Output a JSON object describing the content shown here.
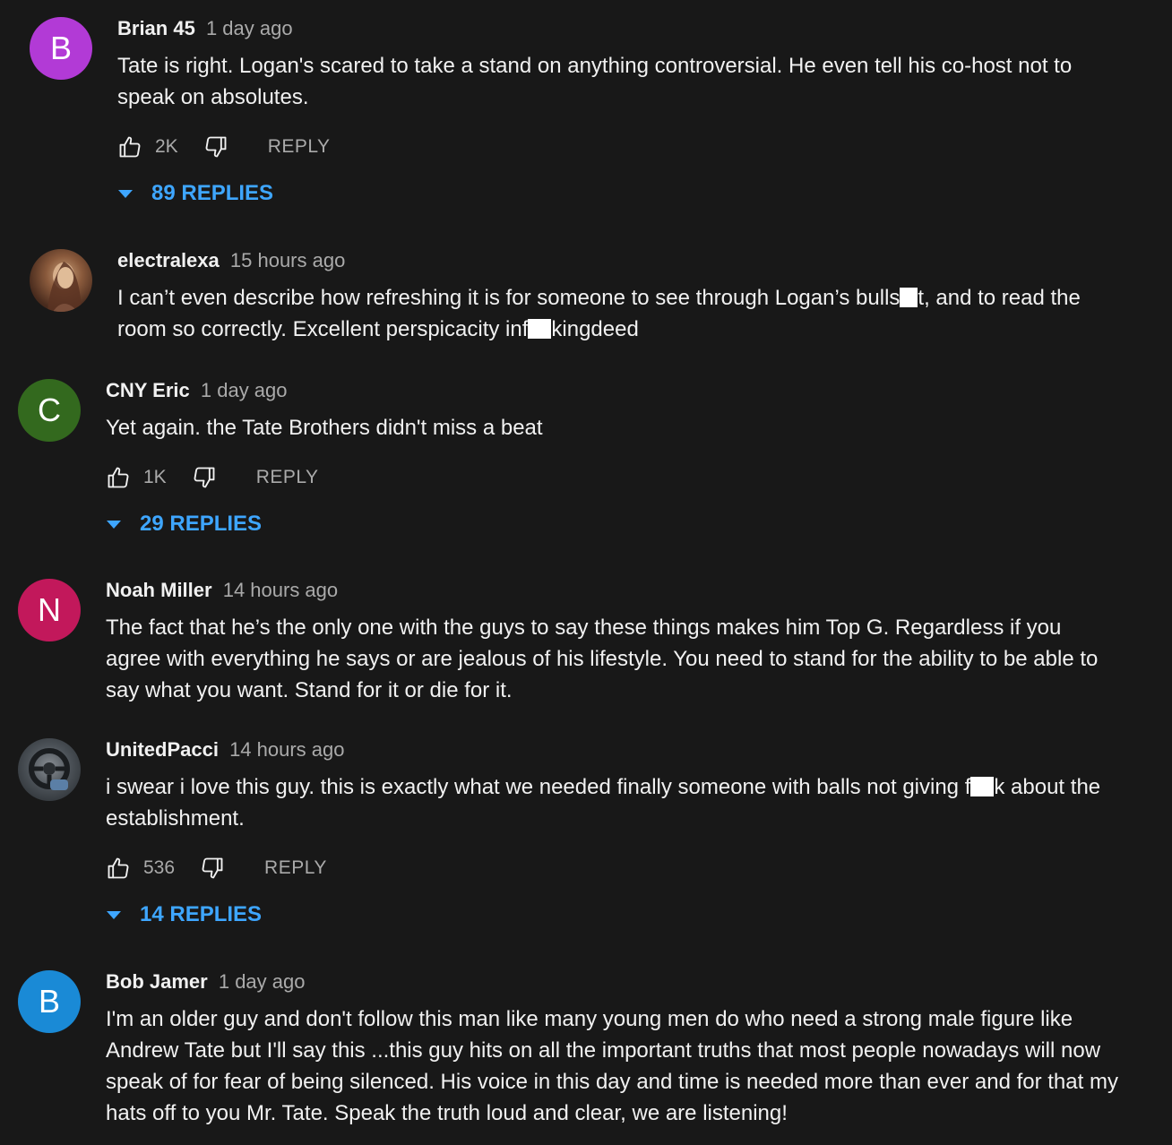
{
  "comments": [
    {
      "author": "Brian 45",
      "time": "1 day ago",
      "avatar_letter": "B",
      "avatar_color": "#b23ad6",
      "text": "Tate is right. Logan's scared to take a stand on anything controversial. He even tell his co-host not to speak on absolutes.",
      "likes": "2K",
      "reply_label": "REPLY",
      "replies_label": "89 REPLIES"
    },
    {
      "author": "electralexa",
      "time": "15 hours ago",
      "text_part1": "I can’t even describe how refreshing it is for someone to see through Logan’s bulls",
      "text_part2": "t, and to read the room so correctly. Excellent perspicacity inf",
      "text_part3": "kingdeed"
    },
    {
      "author": "CNY Eric",
      "time": "1 day ago",
      "avatar_letter": "C",
      "avatar_color": "#33691e",
      "text": "Yet again. the Tate Brothers didn't miss a beat",
      "likes": "1K",
      "reply_label": "REPLY",
      "replies_label": "29 REPLIES"
    },
    {
      "author": "Noah Miller",
      "time": "14 hours ago",
      "avatar_letter": "N",
      "avatar_color": "#c2185b",
      "text": "The fact that he’s the only one with the guys to say these things makes him Top G. Regardless if you agree with everything he says or are jealous of his lifestyle. You need to stand for the ability to be able to say what you want. Stand for it or die for it."
    },
    {
      "author": "UnitedPacci",
      "time": "14 hours ago",
      "text_part1": "i swear i love this guy. this is exactly what we needed finally someone with balls not giving f",
      "text_part2": "k about the establishment.",
      "likes": "536",
      "reply_label": "REPLY",
      "replies_label": "14 REPLIES"
    },
    {
      "author": "Bob Jamer",
      "time": "1 day ago",
      "avatar_letter": "B",
      "avatar_color": "#1a8ad6",
      "text": "I'm an older guy and don't follow this man like many young men do who need a strong male figure like Andrew Tate but I'll say this ...this guy hits on all the important truths that most people nowadays will now speak of for fear of being silenced. His voice in this day and time is needed more than ever and for that my hats off to you Mr. Tate. Speak the truth loud and clear, we are listening!"
    }
  ],
  "colors": {
    "background": "#181818",
    "text": "#f1f1f1",
    "secondary_text": "#aaaaaa",
    "link": "#3ea6ff"
  },
  "icons": [
    "like-icon",
    "dislike-icon",
    "caret-down-icon"
  ]
}
